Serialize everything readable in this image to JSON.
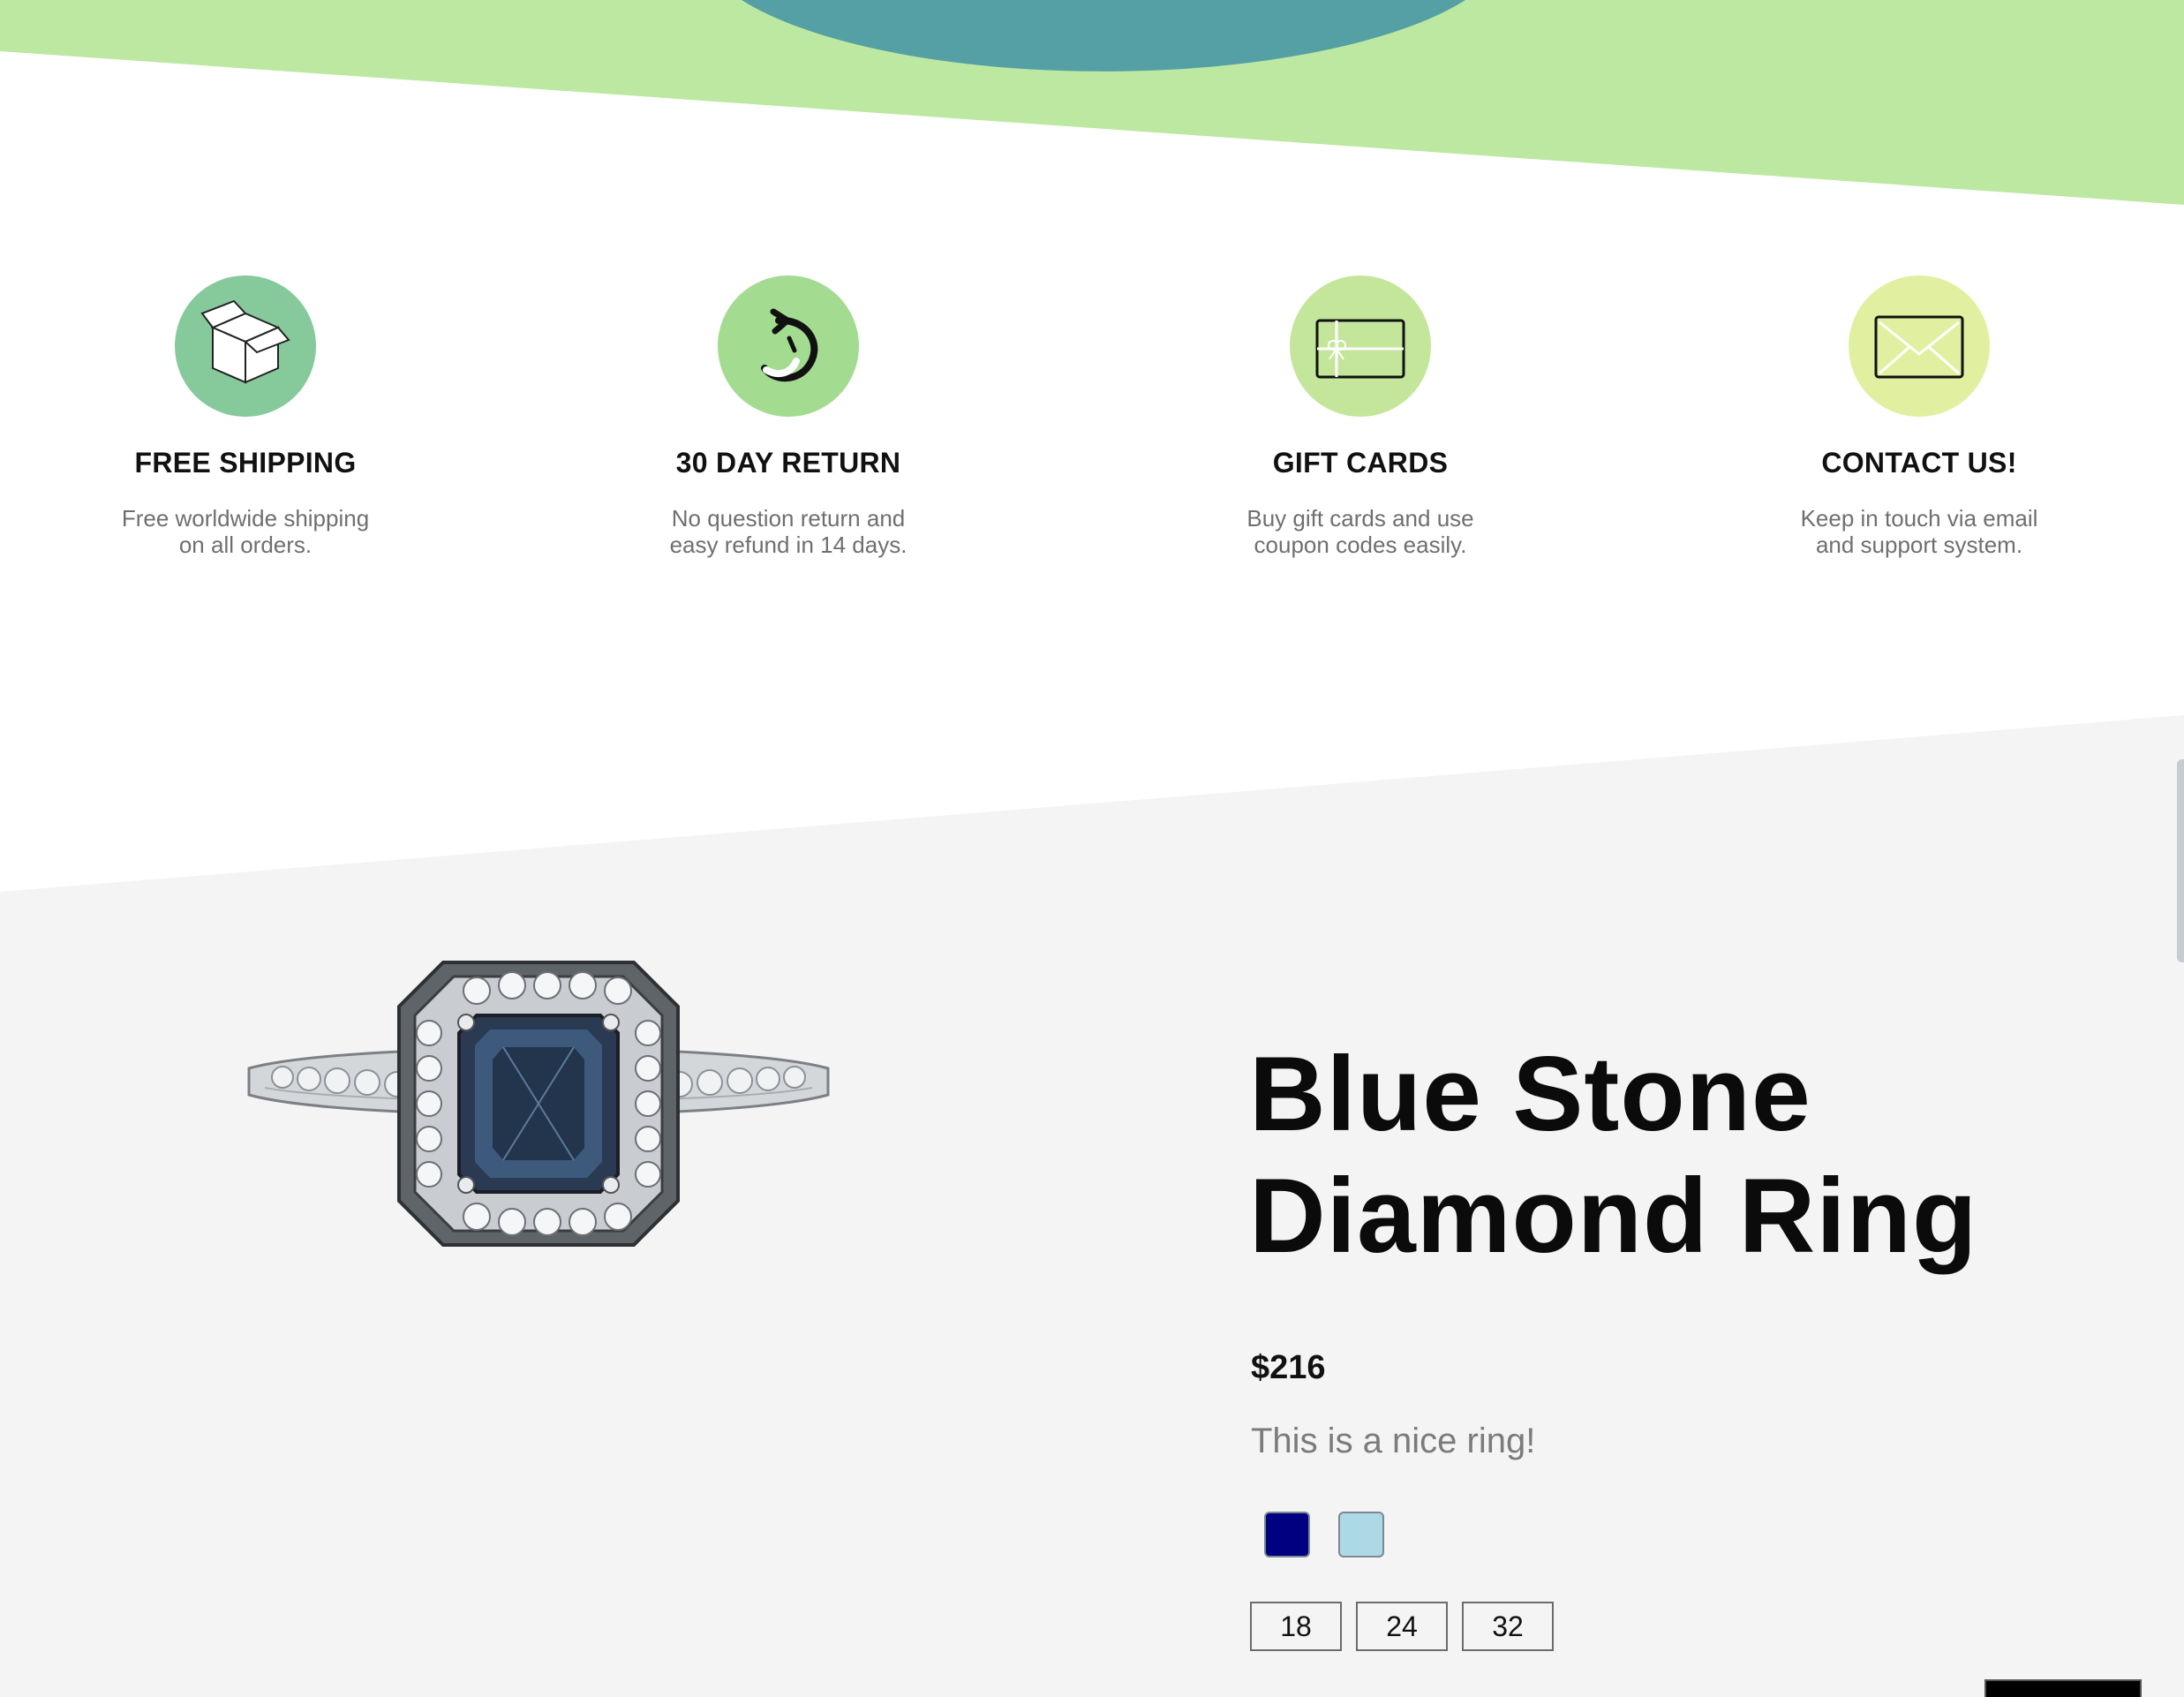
{
  "colors": {
    "hero_green": "#bde8a1",
    "hero_teal": "#55a0a5",
    "product_bg": "#f4f4f4",
    "swatch_navy": "#000080",
    "swatch_light_blue": "#add8e6"
  },
  "features": [
    {
      "icon": "box-icon",
      "color": "#86c99a",
      "title": "FREE SHIPPING",
      "text": "Free worldwide shipping on all orders."
    },
    {
      "icon": "return-arrow-icon",
      "color": "#a3dc90",
      "title": "30 DAY RETURN",
      "text": "No question return and easy refund in 14 days."
    },
    {
      "icon": "gift-card-icon",
      "color": "#c4e69a",
      "title": "GIFT CARDS",
      "text": "Buy gift cards and use coupon codes easily."
    },
    {
      "icon": "envelope-icon",
      "color": "#e1f0a0",
      "title": "CONTACT US!",
      "text": "Keep in touch via email and support system."
    }
  ],
  "product": {
    "image_icon": "ring-image",
    "title": "Blue Stone Diamond Ring",
    "price": "$216",
    "description": "This is a nice ring!",
    "colors": [
      "#000080",
      "#add8e6"
    ],
    "sizes": [
      "18",
      "24",
      "32"
    ]
  }
}
